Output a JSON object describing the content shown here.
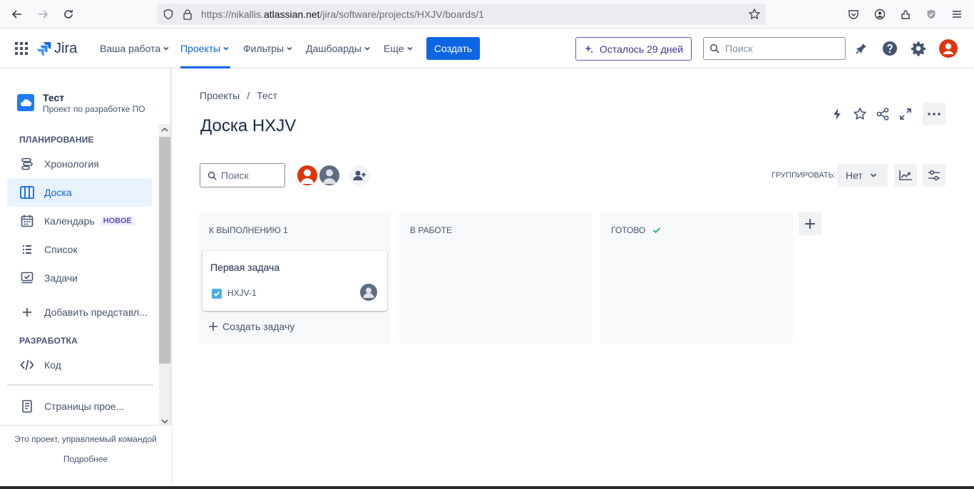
{
  "browser": {
    "url_prefix": "https://nikallis.",
    "url_host": "atlassian.net",
    "url_path": "/jira/software/projects/HXJV/boards/1"
  },
  "topnav": {
    "logo_text": "Jira",
    "items": [
      {
        "label": "Ваша работа"
      },
      {
        "label": "Проекты"
      },
      {
        "label": "Фильтры"
      },
      {
        "label": "Дашбоарды"
      },
      {
        "label": "Еще"
      }
    ],
    "create_label": "Создать",
    "trial_label": "Осталось 29 дней",
    "search_placeholder": "Поиск"
  },
  "sidebar": {
    "project_name": "Тест",
    "project_type": "Проект по разработке ПО",
    "planning_heading": "ПЛАНИРОВАНИЕ",
    "items": [
      {
        "label": "Хронология"
      },
      {
        "label": "Доска"
      },
      {
        "label": "Календарь",
        "badge": "НОВОЕ"
      },
      {
        "label": "Список"
      },
      {
        "label": "Задачи"
      },
      {
        "label": "Добавить представл..."
      }
    ],
    "dev_heading": "РАЗРАБОТКА",
    "code_label": "Код",
    "pages_label": "Страницы прое...",
    "footer_text": "Это проект, управляемый командой",
    "footer_link": "Подробнее"
  },
  "main": {
    "breadcrumbs": [
      "Проекты",
      "/",
      "Тест"
    ],
    "title": "Доска HXJV",
    "search_placeholder": "Поиск",
    "group_label": "ГРУППИРОВАТЬ:",
    "group_value": "Нет",
    "columns": [
      {
        "title": "К ВЫПОЛНЕНИЮ 1"
      },
      {
        "title": "В РАБОТЕ"
      },
      {
        "title": "ГОТОВО"
      }
    ],
    "card": {
      "title": "Первая задача",
      "key": "HXJV-1"
    },
    "create_issue_label": "Создать задачу"
  },
  "colors": {
    "accent": "#0C66E4",
    "trial_purple": "#6554C0",
    "avatar_red": "#DE350B",
    "avatar_grey": "#5E6C84",
    "done_green": "#22A06B"
  }
}
